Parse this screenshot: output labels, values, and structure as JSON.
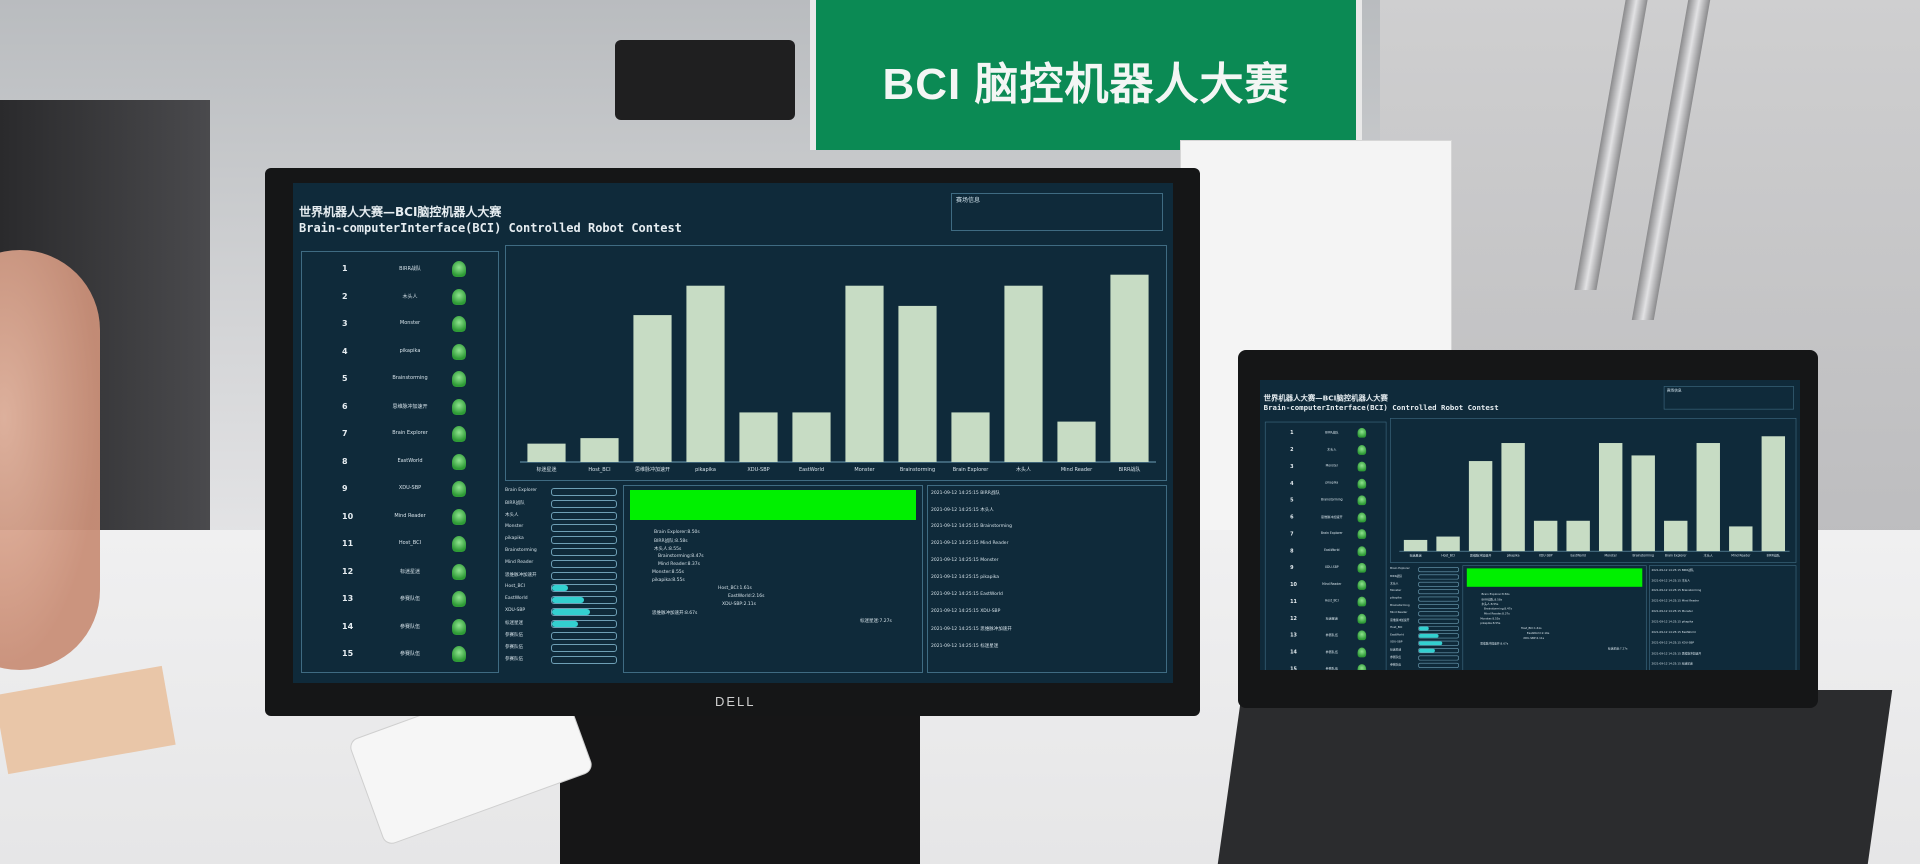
{
  "banner": {
    "title": "BCI 脑控机器人大赛"
  },
  "monitor": {
    "brand": "DELL"
  },
  "app": {
    "title_cn": "世界机器人大赛—BCI脑控机器人大赛",
    "title_en": "Brain-computerInterface(BCI) Controlled Robot Contest",
    "info_header": "赛场信息",
    "teams": [
      {
        "no": "1",
        "name": "BIRR战队"
      },
      {
        "no": "2",
        "name": "木头人"
      },
      {
        "no": "3",
        "name": "Monster"
      },
      {
        "no": "4",
        "name": "pikapika"
      },
      {
        "no": "5",
        "name": "Brainstorming"
      },
      {
        "no": "6",
        "name": "思维脉冲加速开"
      },
      {
        "no": "7",
        "name": "Brain Explorer"
      },
      {
        "no": "8",
        "name": "EastWorld"
      },
      {
        "no": "9",
        "name": "XDU-SBP"
      },
      {
        "no": "10",
        "name": "Mind Reader"
      },
      {
        "no": "11",
        "name": "Host_BCI"
      },
      {
        "no": "12",
        "name": "标迷星迷"
      },
      {
        "no": "13",
        "name": "参赛队伍"
      },
      {
        "no": "14",
        "name": "参赛队伍"
      },
      {
        "no": "15",
        "name": "参赛队伍"
      }
    ],
    "bar_rows": [
      {
        "label": "Brain Explorer",
        "fill": 0.0
      },
      {
        "label": "BIRR战队",
        "fill": 0.0
      },
      {
        "label": "木头人",
        "fill": 0.0
      },
      {
        "label": "Monster",
        "fill": 0.0
      },
      {
        "label": "pikapika",
        "fill": 0.0
      },
      {
        "label": "Brainstorming",
        "fill": 0.0
      },
      {
        "label": "Mind Reader",
        "fill": 0.0
      },
      {
        "label": "思维脉冲加速开",
        "fill": 0.0
      },
      {
        "label": "Host_BCI",
        "fill": 0.25
      },
      {
        "label": "EastWorld",
        "fill": 0.5
      },
      {
        "label": "XDU-SBP",
        "fill": 0.6
      },
      {
        "label": "标迷星迷",
        "fill": 0.4
      },
      {
        "label": "参赛队伍",
        "fill": 0.0
      },
      {
        "label": "参赛队伍",
        "fill": 0.0
      },
      {
        "label": "参赛队伍",
        "fill": 0.0
      }
    ],
    "track_labels": [
      "Brain Explorer:8.50s",
      "BIRR战队:8.58s",
      "木头人:8.55s",
      "Brainstorming:8.47s",
      "Mind Reader:8.37s",
      "Monster:8.55s",
      "pikapika:8.55s",
      "Host_BCI:1.61s",
      "EastWorld:2.16s",
      "XDU-SBP:2.11s",
      "思维脉冲加速开:8.67s",
      "标迷星迷:7.27s"
    ],
    "log": [
      "2021-09-12 14:25:15 BIRR战队",
      "2021-09-12 14:25:15 木头人",
      "2021-09-12 14:25:15 Brainstorming",
      "2021-09-12 14:25:15 Mind Reader",
      "2021-09-12 14:25:15 Monster",
      "2021-09-12 14:25:15 pikapika",
      "2021-09-12 14:25:15 EastWorld",
      "2021-09-12 14:25:15 XDU-SBP",
      "2021-09-12 14:25:15 思维脉冲加速开",
      "2021-09-12 14:25:15 标迷星迷"
    ]
  },
  "chart_data": {
    "type": "bar",
    "categories": [
      "标迷星迷",
      "Host_BCI",
      "思维脉冲加速开",
      "pikapika",
      "XDU-SBP",
      "EastWorld",
      "Monster",
      "Brainstorming",
      "Brain Explorer",
      "木头人",
      "Mind Reader",
      "BIRR战队"
    ],
    "values": [
      1.0,
      1.3,
      8.0,
      9.6,
      2.7,
      2.7,
      9.6,
      8.5,
      2.7,
      9.6,
      2.2,
      10.2
    ],
    "ylim": [
      0,
      11
    ],
    "bar_color": "#c7dcc4",
    "title": "",
    "xlabel": "",
    "ylabel": ""
  },
  "colors": {
    "screen_bg": "#0f2a3a",
    "panel_border": "#3f6b82",
    "bar": "#c7dcc4",
    "progress_green": "#00f000",
    "banner_green": "#0b8a54"
  }
}
